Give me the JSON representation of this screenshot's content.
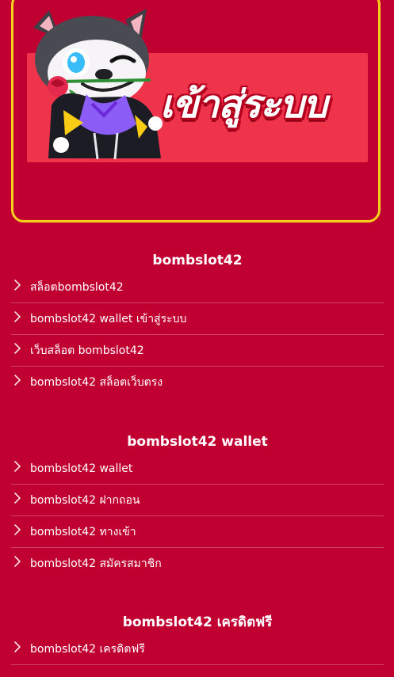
{
  "banner": {
    "text": "เข้าสู่ระบบ",
    "icon": "wolf-mascot-holding-rose"
  },
  "sections": [
    {
      "title": "bombslot42",
      "items": [
        "สล็อตbombslot42",
        "bombslot42 wallet เข้าสู่ระบบ",
        "เว็บสล็อต bombslot42",
        "bombslot42 สล็อตเว็บตรง"
      ]
    },
    {
      "title": "bombslot42 wallet",
      "items": [
        "bombslot42 wallet",
        "bombslot42 ฝากถอน",
        "bombslot42 ทางเข้า",
        "bombslot42 สมัครสมาชิก"
      ]
    },
    {
      "title": "bombslot42 เครดิตฟรี",
      "items": [
        "bombslot42 เครดิตฟรี"
      ]
    }
  ],
  "colors": {
    "background": "#c10032",
    "border": "#f5d21b",
    "banner": "#ee334b",
    "text": "#ffffff"
  }
}
